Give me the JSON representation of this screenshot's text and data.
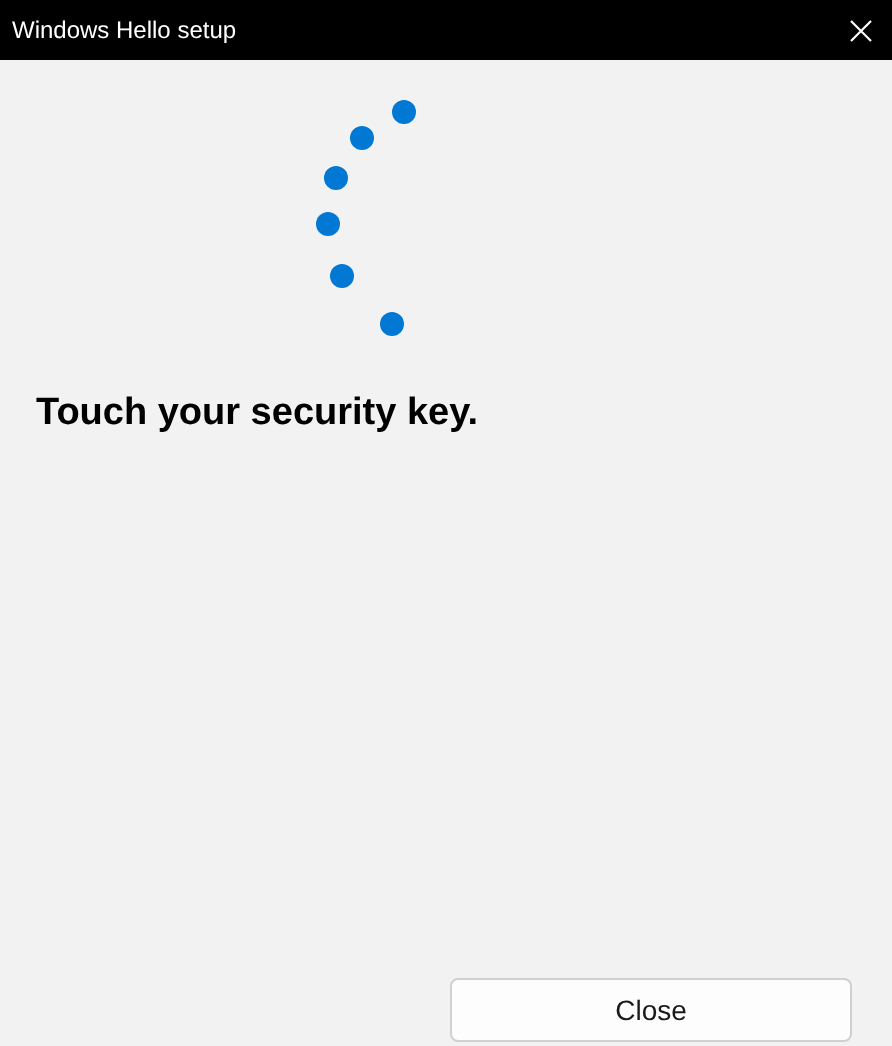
{
  "window": {
    "title": "Windows Hello setup"
  },
  "heading": "Touch your security key.",
  "buttons": [
    {
      "label": "Close"
    }
  ]
}
